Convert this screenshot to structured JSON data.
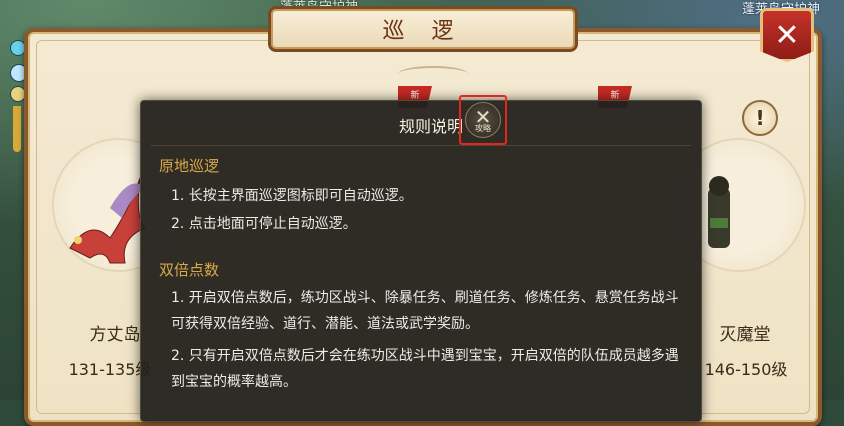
{
  "scene": {
    "top_left_text": "蓬莱岛守护神",
    "top_right_text": "蓬莱岛守护神"
  },
  "panel": {
    "title": "巡 逻",
    "close_glyph": "✕",
    "info_glyph": "!"
  },
  "cards": [
    {
      "name": "方丈岛",
      "level": "131-135级"
    },
    {
      "name": "灭魔堂",
      "level": "146-150级"
    }
  ],
  "dialog": {
    "title": "规则说明",
    "close_glyph": "✕",
    "close_sublabel": "攻略",
    "sections": [
      {
        "title": "原地巡逻",
        "rules": [
          "1. 长按主界面巡逻图标即可自动巡逻。",
          "2. 点击地面可停止自动巡逻。"
        ]
      },
      {
        "title": "双倍点数",
        "rules": [
          "1. 开启双倍点数后，练功区战斗、除暴任务、刷道任务、修炼任务、悬赏任务战斗可获得双倍经验、道行、潜能、道法或武学奖励。",
          "2. 只有开启双倍点数后才会在练功区战斗中遇到宝宝，开启双倍的队伍成员越多遇到宝宝的概率越高。"
        ]
      }
    ]
  },
  "colors": {
    "accent_gold": "#dba94a",
    "close_highlight": "#e0281e",
    "panel_border": "#8a5a2c"
  }
}
